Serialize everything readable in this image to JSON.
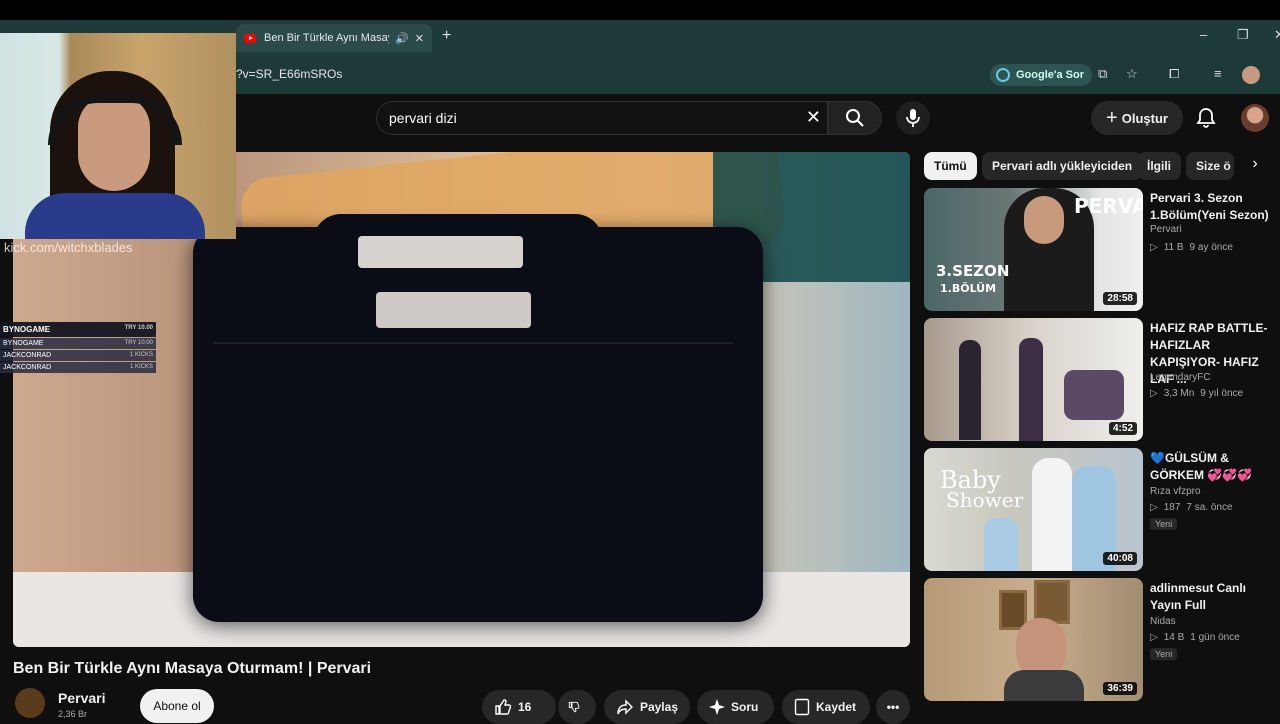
{
  "browser": {
    "tab_title": "Ben Bir Türkle Aynı Masaya",
    "tab_audio_icon": "speaker-icon",
    "url": "?v=SR_E66mSROs",
    "ask_google": "Google'a Sor"
  },
  "youtube": {
    "search_query": "pervari dizi",
    "create_label": "Oluştur"
  },
  "stream_overlay": {
    "watermark": "kick.com/witchxblades",
    "donations": [
      {
        "name": "BYNOGAME",
        "amount": "TRY 10.00"
      },
      {
        "name": "BYNOGAME",
        "amount": "TRY 10.00"
      },
      {
        "name": "JACKCONRAD",
        "amount": "1 KICKS"
      },
      {
        "name": "JACKCONRAD",
        "amount": "1 KICKS"
      }
    ]
  },
  "video": {
    "title": "Ben Bir Türkle Aynı Masaya Oturmam! | Pervari",
    "channel": "Pervari",
    "subscribers": "2,36 Br",
    "subscribe_label": "Abone ol",
    "likes": "16",
    "share_label": "Paylaş",
    "ask_label": "Soru",
    "save_label": "Kaydet"
  },
  "chips": [
    "Tümü",
    "Pervari adlı yükleyiciden",
    "İlgili",
    "Size ö"
  ],
  "recommendations": [
    {
      "title": "Pervari 3. Sezon 1.Bölüm(Yeni Sezon)",
      "channel": "Pervari",
      "views": "11 B",
      "age": "9 ay önce",
      "duration": "28:58",
      "badge": "",
      "thumb_text": [
        "PERVARİ",
        "3.SEZON",
        "1.BÖLÜM"
      ]
    },
    {
      "title": "HAFIZ RAP BATTLE- HAFIZLAR KAPIŞIYOR- HAFIZ LAF ...",
      "channel": "LegendaryFC",
      "views": "3,3 Mn",
      "age": "9 yıl önce",
      "duration": "4:52",
      "badge": "",
      "thumb_text": []
    },
    {
      "title": "💙GÜLSÜM & GÖRKEM 💞💞💞",
      "channel": "Rıza vfzpro",
      "views": "187",
      "age": "7 sa. önce",
      "duration": "40:08",
      "badge": "Yeni",
      "thumb_text": [
        "Baby",
        "Shower"
      ]
    },
    {
      "title": "adlinmesut Canlı Yayın Full",
      "channel": "Nidas",
      "views": "14 B",
      "age": "1 gün önce",
      "duration": "36:39",
      "badge": "Yeni",
      "thumb_text": []
    }
  ],
  "colors": {
    "brand_red": "#ff0000",
    "background": "#0f0f0f",
    "chip_bg": "#272727"
  }
}
